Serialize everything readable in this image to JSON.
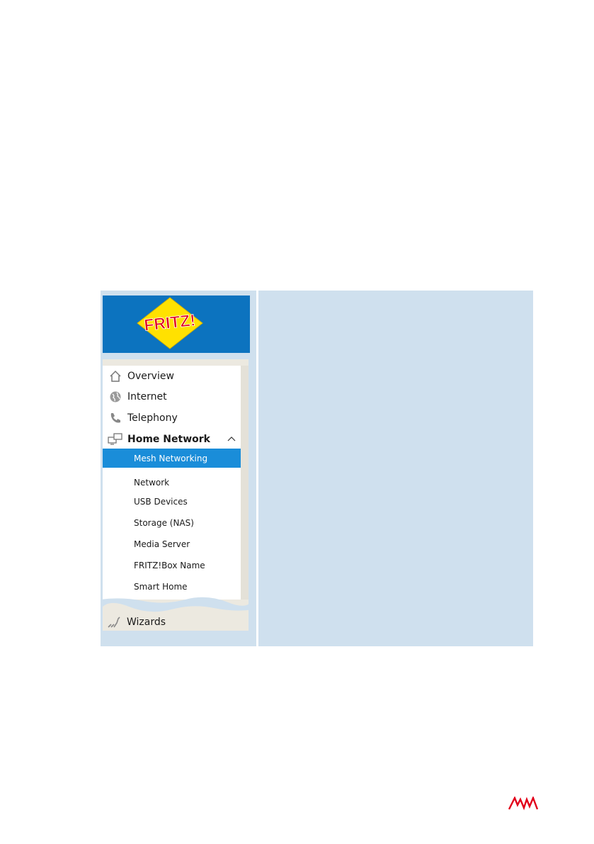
{
  "brand": {
    "logo_text": "FRITZ!",
    "header_color": "#0c73bf"
  },
  "nav": {
    "items": [
      {
        "label": "Overview",
        "icon": "home-icon"
      },
      {
        "label": "Internet",
        "icon": "globe-icon"
      },
      {
        "label": "Telephony",
        "icon": "phone-icon"
      },
      {
        "label": "Home Network",
        "icon": "network-icon",
        "expanded": true
      }
    ],
    "subitems": [
      {
        "label": "Mesh Networking",
        "active": true
      },
      {
        "label": "Network"
      },
      {
        "label": "USB Devices"
      },
      {
        "label": "Storage (NAS)"
      },
      {
        "label": "Media Server"
      },
      {
        "label": "FRITZ!Box Name"
      },
      {
        "label": "Smart Home"
      }
    ],
    "wizards": {
      "label": "Wizards",
      "icon": "wizard-icon"
    }
  },
  "colors": {
    "active": "#1a8dd9",
    "panel": "#cfe0ee"
  },
  "footer": {
    "logo": "avm-logo"
  }
}
